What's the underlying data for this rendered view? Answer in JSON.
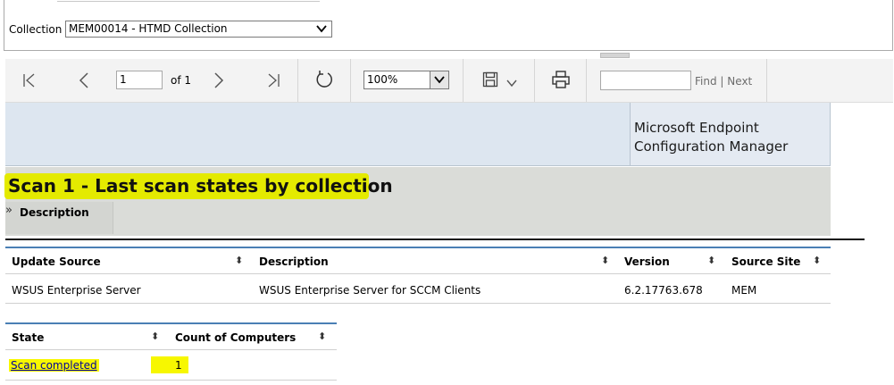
{
  "params": {
    "collection_label": "Collection",
    "collection_value": "MEM00014 - HTMD Collection"
  },
  "toolbar": {
    "page_value": "1",
    "of_label": "of 1",
    "zoom_value": "100%",
    "find_label": "Find",
    "separator": "|",
    "next_label": "Next"
  },
  "report": {
    "brand_line1": "Microsoft Endpoint",
    "brand_line2": "Configuration Manager",
    "title": "Scan 1 - Last scan states by collection",
    "description_label": "Description"
  },
  "source_table": {
    "headers": [
      "Update Source",
      "Description",
      "Version",
      "Source Site"
    ],
    "rows": [
      [
        "WSUS Enterprise Server",
        "WSUS Enterprise Server for SCCM Clients",
        "6.2.17763.678",
        "MEM"
      ]
    ]
  },
  "state_table": {
    "headers": [
      "State",
      "Count of Computers"
    ],
    "rows": [
      [
        "Scan completed",
        "1"
      ]
    ]
  },
  "colors": {
    "highlight": "#f7f700",
    "header_band": "#dde6f0",
    "title_band": "#dadcd8",
    "table_rule": "#4a7fb5"
  },
  "icons": [
    "first-page-icon",
    "previous-page-icon",
    "next-page-icon",
    "last-page-icon",
    "refresh-icon",
    "save-icon",
    "chevron-down-icon",
    "print-icon",
    "expand-chevron-icon",
    "sort-icon"
  ]
}
